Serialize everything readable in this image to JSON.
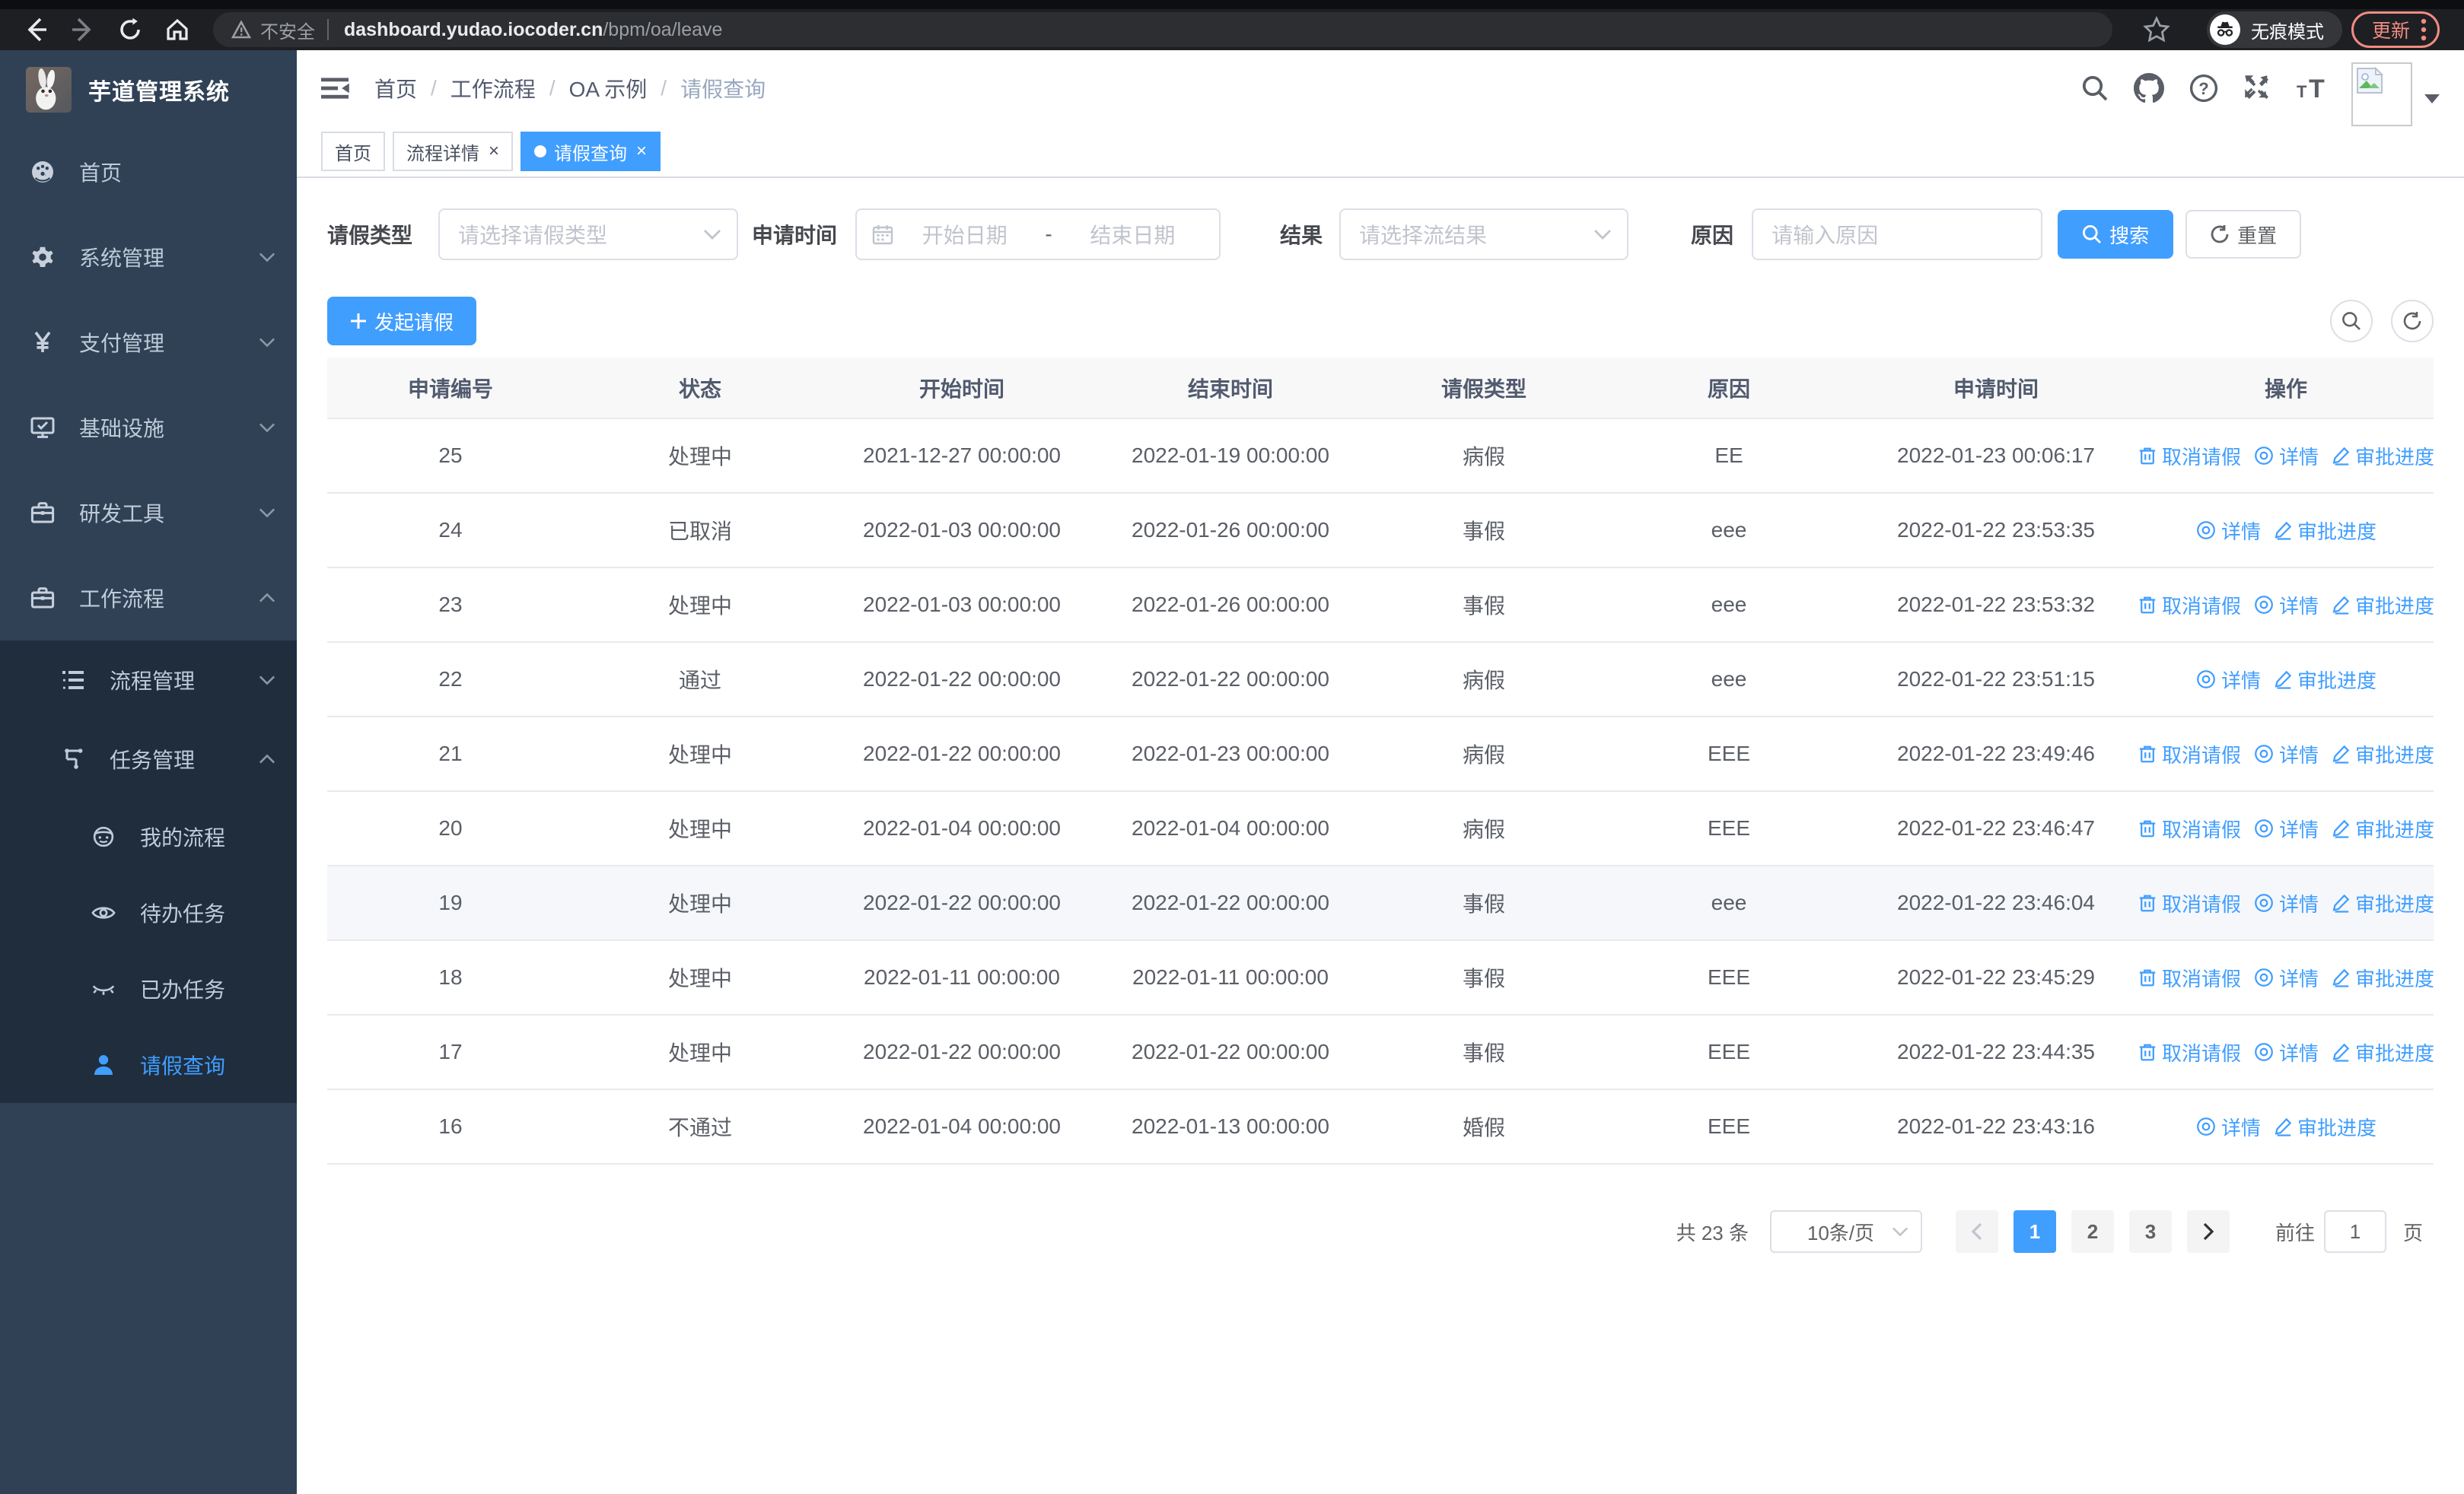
{
  "browser": {
    "security_label": "不安全",
    "url_host": "dashboard.yudao.iocoder.cn",
    "url_path": "/bpm/oa/leave",
    "incognito_label": "无痕模式",
    "update_label": "更新"
  },
  "sidebar": {
    "logo_title": "芋道管理系统",
    "menu": [
      {
        "label": "首页",
        "icon": "dashboard-icon",
        "level": 1
      },
      {
        "label": "系统管理",
        "icon": "gear-icon",
        "level": 1,
        "chevron": "down"
      },
      {
        "label": "支付管理",
        "icon": "yen-icon",
        "level": 1,
        "chevron": "down"
      },
      {
        "label": "基础设施",
        "icon": "monitor-icon",
        "level": 1,
        "chevron": "down"
      },
      {
        "label": "研发工具",
        "icon": "toolbox-icon",
        "level": 1,
        "chevron": "down"
      },
      {
        "label": "工作流程",
        "icon": "briefcase-icon",
        "level": 1,
        "chevron": "up"
      },
      {
        "label": "流程管理",
        "icon": "tree-icon",
        "level": 2,
        "chevron": "down",
        "group": "dark"
      },
      {
        "label": "任务管理",
        "icon": "flow-icon",
        "level": 2,
        "chevron": "up",
        "group": "dark"
      },
      {
        "label": "我的流程",
        "icon": "robot-icon",
        "level": 3,
        "group": "dark"
      },
      {
        "label": "待办任务",
        "icon": "eye-open-icon",
        "level": 3,
        "group": "dark"
      },
      {
        "label": "已办任务",
        "icon": "eye-closed-icon",
        "level": 3,
        "group": "dark"
      },
      {
        "label": "请假查询",
        "icon": "person-icon",
        "level": 3,
        "group": "dark",
        "active": true
      }
    ]
  },
  "header": {
    "breadcrumb": [
      {
        "label": "首页"
      },
      {
        "label": "工作流程"
      },
      {
        "label": "OA 示例"
      },
      {
        "label": "请假查询",
        "muted": true
      }
    ]
  },
  "tabs": [
    {
      "label": "首页",
      "closable": false,
      "active": false
    },
    {
      "label": "流程详情",
      "closable": true,
      "active": false
    },
    {
      "label": "请假查询",
      "closable": true,
      "active": true
    }
  ],
  "filters": {
    "type_label": "请假类型",
    "type_placeholder": "请选择请假类型",
    "time_label": "申请时间",
    "start_placeholder": "开始日期",
    "range_separator": "-",
    "end_placeholder": "结束日期",
    "result_label": "结果",
    "result_placeholder": "请选择流结果",
    "reason_label": "原因",
    "reason_placeholder": "请输入原因",
    "search_label": "搜索",
    "reset_label": "重置"
  },
  "toolbar": {
    "create_label": "发起请假"
  },
  "table": {
    "columns": [
      "申请编号",
      "状态",
      "开始时间",
      "结束时间",
      "请假类型",
      "原因",
      "申请时间",
      "操作"
    ],
    "rows": [
      {
        "id": "25",
        "status": "处理中",
        "start": "2021-12-27 00:00:00",
        "end": "2022-01-19 00:00:00",
        "type": "病假",
        "reason": "EE",
        "apply": "2022-01-23 00:06:17",
        "actions": [
          {
            "label": "取消请假",
            "icon": "delete-icon"
          },
          {
            "label": "详情",
            "icon": "view-icon"
          },
          {
            "label": "审批进度",
            "icon": "edit-icon"
          }
        ]
      },
      {
        "id": "24",
        "status": "已取消",
        "start": "2022-01-03 00:00:00",
        "end": "2022-01-26 00:00:00",
        "type": "事假",
        "reason": "eee",
        "apply": "2022-01-22 23:53:35",
        "actions": [
          {
            "label": "详情",
            "icon": "view-icon"
          },
          {
            "label": "审批进度",
            "icon": "edit-icon"
          }
        ]
      },
      {
        "id": "23",
        "status": "处理中",
        "start": "2022-01-03 00:00:00",
        "end": "2022-01-26 00:00:00",
        "type": "事假",
        "reason": "eee",
        "apply": "2022-01-22 23:53:32",
        "actions": [
          {
            "label": "取消请假",
            "icon": "delete-icon"
          },
          {
            "label": "详情",
            "icon": "view-icon"
          },
          {
            "label": "审批进度",
            "icon": "edit-icon"
          }
        ]
      },
      {
        "id": "22",
        "status": "通过",
        "start": "2022-01-22 00:00:00",
        "end": "2022-01-22 00:00:00",
        "type": "病假",
        "reason": "eee",
        "apply": "2022-01-22 23:51:15",
        "actions": [
          {
            "label": "详情",
            "icon": "view-icon"
          },
          {
            "label": "审批进度",
            "icon": "edit-icon"
          }
        ]
      },
      {
        "id": "21",
        "status": "处理中",
        "start": "2022-01-22 00:00:00",
        "end": "2022-01-23 00:00:00",
        "type": "病假",
        "reason": "EEE",
        "apply": "2022-01-22 23:49:46",
        "actions": [
          {
            "label": "取消请假",
            "icon": "delete-icon"
          },
          {
            "label": "详情",
            "icon": "view-icon"
          },
          {
            "label": "审批进度",
            "icon": "edit-icon"
          }
        ]
      },
      {
        "id": "20",
        "status": "处理中",
        "start": "2022-01-04 00:00:00",
        "end": "2022-01-04 00:00:00",
        "type": "病假",
        "reason": "EEE",
        "apply": "2022-01-22 23:46:47",
        "actions": [
          {
            "label": "取消请假",
            "icon": "delete-icon"
          },
          {
            "label": "详情",
            "icon": "view-icon"
          },
          {
            "label": "审批进度",
            "icon": "edit-icon"
          }
        ]
      },
      {
        "id": "19",
        "status": "处理中",
        "start": "2022-01-22 00:00:00",
        "end": "2022-01-22 00:00:00",
        "type": "事假",
        "reason": "eee",
        "apply": "2022-01-22 23:46:04",
        "highlighted": true,
        "actions": [
          {
            "label": "取消请假",
            "icon": "delete-icon"
          },
          {
            "label": "详情",
            "icon": "view-icon"
          },
          {
            "label": "审批进度",
            "icon": "edit-icon"
          }
        ]
      },
      {
        "id": "18",
        "status": "处理中",
        "start": "2022-01-11 00:00:00",
        "end": "2022-01-11 00:00:00",
        "type": "事假",
        "reason": "EEE",
        "apply": "2022-01-22 23:45:29",
        "actions": [
          {
            "label": "取消请假",
            "icon": "delete-icon"
          },
          {
            "label": "详情",
            "icon": "view-icon"
          },
          {
            "label": "审批进度",
            "icon": "edit-icon"
          }
        ]
      },
      {
        "id": "17",
        "status": "处理中",
        "start": "2022-01-22 00:00:00",
        "end": "2022-01-22 00:00:00",
        "type": "事假",
        "reason": "EEE",
        "apply": "2022-01-22 23:44:35",
        "actions": [
          {
            "label": "取消请假",
            "icon": "delete-icon"
          },
          {
            "label": "详情",
            "icon": "view-icon"
          },
          {
            "label": "审批进度",
            "icon": "edit-icon"
          }
        ]
      },
      {
        "id": "16",
        "status": "不通过",
        "start": "2022-01-04 00:00:00",
        "end": "2022-01-13 00:00:00",
        "type": "婚假",
        "reason": "EEE",
        "apply": "2022-01-22 23:43:16",
        "actions": [
          {
            "label": "详情",
            "icon": "view-icon"
          },
          {
            "label": "审批进度",
            "icon": "edit-icon"
          }
        ]
      }
    ]
  },
  "pagination": {
    "total_label": "共 23 条",
    "page_size_label": "10条/页",
    "pages": [
      "1",
      "2",
      "3"
    ],
    "active_page": "1",
    "goto_label": "前往",
    "goto_value": "1",
    "unit_label": "页"
  }
}
